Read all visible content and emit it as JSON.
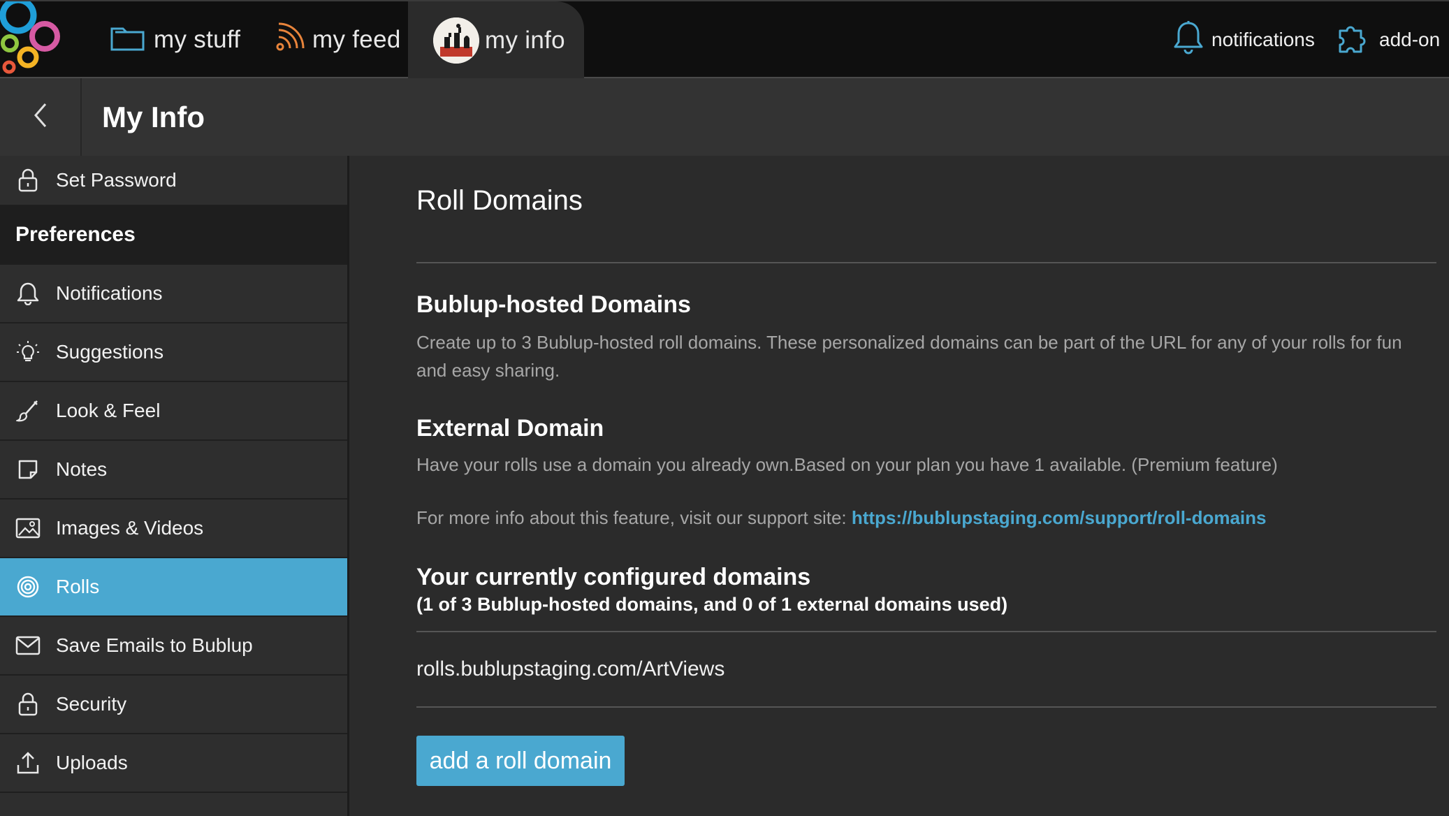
{
  "topbar": {
    "tabs": [
      {
        "label": "my stuff",
        "icon": "folder-icon"
      },
      {
        "label": "my feed",
        "icon": "rss-icon"
      },
      {
        "label": "my info",
        "icon": "avatar"
      }
    ],
    "actions": [
      {
        "label": "notifications",
        "icon": "bell-icon"
      },
      {
        "label": "add-on",
        "icon": "puzzle-icon"
      }
    ]
  },
  "header": {
    "title": "My Info"
  },
  "sidebar": {
    "items": [
      {
        "label": "Set Password",
        "icon": "lock-icon"
      },
      {
        "label": "Preferences",
        "heading": true
      },
      {
        "label": "Notifications",
        "icon": "bell-icon"
      },
      {
        "label": "Suggestions",
        "icon": "lightbulb-icon"
      },
      {
        "label": "Look & Feel",
        "icon": "brush-icon"
      },
      {
        "label": "Notes",
        "icon": "note-icon"
      },
      {
        "label": "Images & Videos",
        "icon": "image-icon"
      },
      {
        "label": "Rolls",
        "icon": "spiral-icon",
        "active": true
      },
      {
        "label": "Save Emails to Bublup",
        "icon": "envelope-icon"
      },
      {
        "label": "Security",
        "icon": "lock-icon"
      },
      {
        "label": "Uploads",
        "icon": "upload-icon"
      }
    ]
  },
  "main": {
    "title": "Roll Domains",
    "hosted": {
      "heading": "Bublup-hosted Domains",
      "description": "Create up to 3 Bublup-hosted roll domains. These personalized domains can be part of the URL for any of your rolls for fun and easy sharing."
    },
    "external": {
      "heading": "External Domain",
      "description": "Have your rolls use a domain you already own.Based on your plan you have 1 available. (Premium feature)",
      "support_prefix": "For more info about this feature, visit our support site: ",
      "support_link": "https://bublupstaging.com/support/roll-domains"
    },
    "configured": {
      "heading": "Your currently configured domains",
      "usage": "(1 of 3 Bublup-hosted domains, and 0 of 1 external domains used)",
      "domains": [
        "rolls.bublupstaging.com/ArtViews"
      ]
    },
    "add_button": "add a roll domain"
  },
  "colors": {
    "accent": "#4aa8d0",
    "topbar_bg": "#0f0f0f",
    "sidebar_bg": "#2e2e2e",
    "content_bg": "#2b2b2b",
    "muted_text": "#a7a7a7"
  }
}
